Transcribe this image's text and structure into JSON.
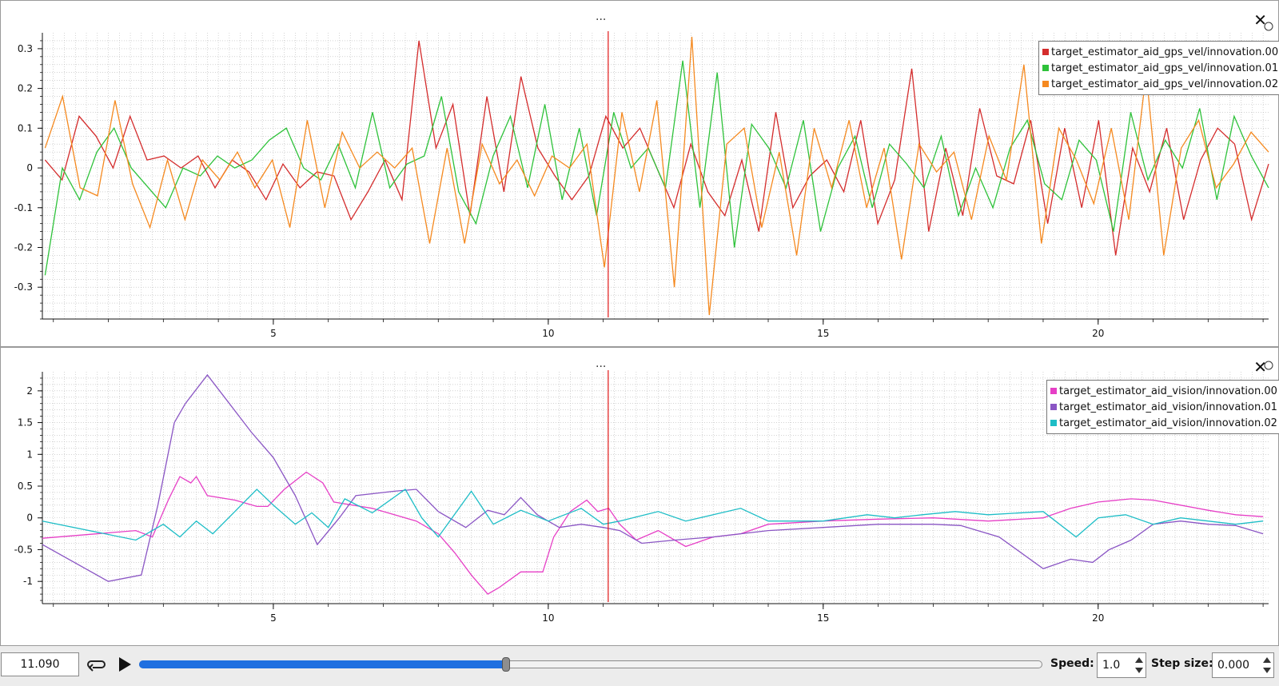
{
  "top_plot": {
    "menu": "...",
    "close": "✕",
    "icon": "close-icon",
    "legend": [
      {
        "label": "target_estimator_aid_gps_vel/innovation.00",
        "color": "#d42c2c"
      },
      {
        "label": "target_estimator_aid_gps_vel/innovation.01",
        "color": "#2ec23a"
      },
      {
        "label": "target_estimator_aid_gps_vel/innovation.02",
        "color": "#f5891f"
      }
    ],
    "y_ticks": [
      "0.3",
      "0.2",
      "0.1",
      "0",
      "-0.1",
      "-0.2",
      "-0.3"
    ],
    "x_ticks": [
      "5",
      "10",
      "15",
      "20"
    ]
  },
  "bottom_plot": {
    "menu": "...",
    "close": "✕",
    "icon": "close-icon",
    "legend": [
      {
        "label": "target_estimator_aid_vision/innovation.00",
        "color": "#e63fc6"
      },
      {
        "label": "target_estimator_aid_vision/innovation.01",
        "color": "#8a55c4"
      },
      {
        "label": "target_estimator_aid_vision/innovation.02",
        "color": "#1dbdc6"
      }
    ],
    "y_ticks": [
      "2",
      "1.5",
      "1",
      "0.5",
      "0",
      "-0.5",
      "-1"
    ],
    "x_ticks": [
      "5",
      "10",
      "15",
      "20"
    ]
  },
  "controls": {
    "time_value": "11.090",
    "loop_icon": "loop-icon",
    "play_icon": "play-icon",
    "slider_progress": 0.406,
    "speed_label": "Speed:",
    "speed_value": "1.0",
    "step_label": "Step size:",
    "step_value": "0.000"
  },
  "chart_data": [
    {
      "type": "line",
      "x_range": [
        0.8,
        23.1
      ],
      "ylim": [
        -0.38,
        0.34
      ],
      "cursor_x": 11.09,
      "series": [
        {
          "name": "target_estimator_aid_gps_vel/innovation.00",
          "color": "#d42c2c",
          "values": [
            0.02,
            -0.03,
            0.13,
            0.08,
            0.0,
            0.13,
            0.02,
            0.03,
            0.0,
            0.03,
            -0.05,
            0.02,
            -0.01,
            -0.08,
            0.01,
            -0.05,
            -0.01,
            -0.02,
            -0.13,
            -0.06,
            0.02,
            -0.08,
            0.32,
            0.05,
            0.16,
            -0.12,
            0.18,
            -0.06,
            0.23,
            0.05,
            -0.02,
            -0.08,
            -0.02,
            0.13,
            0.05,
            0.1,
            0.0,
            -0.1,
            0.06,
            -0.06,
            -0.12,
            0.02,
            -0.16,
            0.14,
            -0.1,
            -0.02,
            0.02,
            -0.06,
            0.12,
            -0.14,
            -0.03,
            0.25,
            -0.16,
            0.05,
            -0.12,
            0.15,
            -0.02,
            -0.04,
            0.12,
            -0.14,
            0.1,
            -0.1,
            0.12,
            -0.22,
            0.05,
            -0.06,
            0.1,
            -0.13,
            0.02,
            0.1,
            0.06,
            -0.13,
            0.01
          ]
        },
        {
          "name": "target_estimator_aid_gps_vel/innovation.01",
          "color": "#2ec23a",
          "values": [
            -0.27,
            0.0,
            -0.08,
            0.04,
            0.1,
            0.0,
            -0.05,
            -0.1,
            0.0,
            -0.02,
            0.03,
            0.0,
            0.02,
            0.07,
            0.1,
            0.0,
            -0.03,
            0.06,
            -0.05,
            0.14,
            -0.05,
            0.01,
            0.03,
            0.18,
            -0.06,
            -0.14,
            0.03,
            0.13,
            -0.05,
            0.16,
            -0.08,
            0.1,
            -0.12,
            0.14,
            0.0,
            0.05,
            -0.05,
            0.27,
            -0.1,
            0.24,
            -0.2,
            0.11,
            0.05,
            -0.05,
            0.12,
            -0.16,
            0.0,
            0.08,
            -0.1,
            0.06,
            0.01,
            -0.05,
            0.08,
            -0.12,
            0.0,
            -0.1,
            0.05,
            0.12,
            -0.04,
            -0.08,
            0.07,
            0.02,
            -0.16,
            0.14,
            -0.03,
            0.07,
            0.0,
            0.15,
            -0.08,
            0.13,
            0.03,
            -0.05
          ]
        },
        {
          "name": "target_estimator_aid_gps_vel/innovation.02",
          "color": "#f5891f",
          "values": [
            0.05,
            0.18,
            -0.05,
            -0.07,
            0.17,
            -0.04,
            -0.15,
            0.02,
            -0.13,
            0.02,
            -0.03,
            0.04,
            -0.05,
            0.02,
            -0.15,
            0.12,
            -0.1,
            0.09,
            0.0,
            0.04,
            0.0,
            0.05,
            -0.19,
            0.05,
            -0.19,
            0.06,
            -0.04,
            0.02,
            -0.07,
            0.03,
            0.0,
            0.06,
            -0.25,
            0.14,
            -0.06,
            0.17,
            -0.3,
            0.33,
            -0.37,
            0.06,
            0.1,
            -0.15,
            0.04,
            -0.22,
            0.1,
            -0.05,
            0.12,
            -0.1,
            0.05,
            -0.23,
            0.06,
            -0.01,
            0.04,
            -0.13,
            0.08,
            -0.03,
            0.26,
            -0.19,
            0.1,
            0.02,
            -0.09,
            0.1,
            -0.13,
            0.24,
            -0.22,
            0.05,
            0.12,
            -0.05,
            0.01,
            0.09,
            0.04
          ]
        }
      ]
    },
    {
      "type": "line",
      "x_range": [
        0.8,
        23.1
      ],
      "ylim": [
        -1.35,
        2.3
      ],
      "cursor_x": 11.09,
      "series": [
        {
          "name": "target_estimator_aid_vision/innovation.00",
          "color": "#e63fc6",
          "points": [
            [
              0.8,
              -0.32
            ],
            [
              2.5,
              -0.2
            ],
            [
              2.8,
              -0.3
            ],
            [
              3.1,
              0.3
            ],
            [
              3.3,
              0.65
            ],
            [
              3.5,
              0.55
            ],
            [
              3.6,
              0.65
            ],
            [
              3.8,
              0.35
            ],
            [
              4.3,
              0.28
            ],
            [
              4.7,
              0.18
            ],
            [
              4.9,
              0.18
            ],
            [
              5.2,
              0.45
            ],
            [
              5.6,
              0.72
            ],
            [
              5.9,
              0.55
            ],
            [
              6.1,
              0.25
            ],
            [
              6.8,
              0.15
            ],
            [
              7.2,
              0.05
            ],
            [
              7.6,
              -0.05
            ],
            [
              8.0,
              -0.25
            ],
            [
              8.3,
              -0.55
            ],
            [
              8.6,
              -0.9
            ],
            [
              8.9,
              -1.2
            ],
            [
              9.1,
              -1.1
            ],
            [
              9.5,
              -0.85
            ],
            [
              9.9,
              -0.85
            ],
            [
              10.1,
              -0.3
            ],
            [
              10.4,
              0.1
            ],
            [
              10.7,
              0.28
            ],
            [
              10.9,
              0.1
            ],
            [
              11.1,
              0.15
            ],
            [
              11.3,
              -0.1
            ],
            [
              11.6,
              -0.35
            ],
            [
              12.0,
              -0.2
            ],
            [
              12.5,
              -0.45
            ],
            [
              13.0,
              -0.3
            ],
            [
              13.5,
              -0.25
            ],
            [
              14.0,
              -0.1
            ],
            [
              15.0,
              -0.05
            ],
            [
              16.0,
              -0.02
            ],
            [
              17.0,
              0.0
            ],
            [
              18.0,
              -0.05
            ],
            [
              19.0,
              0.0
            ],
            [
              19.5,
              0.15
            ],
            [
              20.0,
              0.25
            ],
            [
              20.6,
              0.3
            ],
            [
              21.0,
              0.28
            ],
            [
              21.5,
              0.2
            ],
            [
              22.0,
              0.12
            ],
            [
              22.5,
              0.05
            ],
            [
              23.0,
              0.02
            ]
          ]
        },
        {
          "name": "target_estimator_aid_vision/innovation.01",
          "color": "#8a55c4",
          "points": [
            [
              0.8,
              -0.42
            ],
            [
              2.0,
              -1.0
            ],
            [
              2.6,
              -0.9
            ],
            [
              2.9,
              0.2
            ],
            [
              3.2,
              1.5
            ],
            [
              3.4,
              1.8
            ],
            [
              3.8,
              2.25
            ],
            [
              4.2,
              1.8
            ],
            [
              4.6,
              1.35
            ],
            [
              5.0,
              0.95
            ],
            [
              5.4,
              0.35
            ],
            [
              5.8,
              -0.42
            ],
            [
              6.2,
              0.0
            ],
            [
              6.5,
              0.35
            ],
            [
              7.2,
              0.42
            ],
            [
              7.6,
              0.45
            ],
            [
              8.0,
              0.1
            ],
            [
              8.5,
              -0.15
            ],
            [
              8.9,
              0.12
            ],
            [
              9.2,
              0.05
            ],
            [
              9.5,
              0.32
            ],
            [
              9.8,
              0.05
            ],
            [
              10.2,
              -0.15
            ],
            [
              10.6,
              -0.1
            ],
            [
              11.0,
              -0.15
            ],
            [
              11.3,
              -0.2
            ],
            [
              11.7,
              -0.4
            ],
            [
              12.3,
              -0.35
            ],
            [
              13.0,
              -0.3
            ],
            [
              14.0,
              -0.2
            ],
            [
              15.0,
              -0.15
            ],
            [
              16.0,
              -0.1
            ],
            [
              17.0,
              -0.1
            ],
            [
              17.5,
              -0.12
            ],
            [
              18.2,
              -0.3
            ],
            [
              19.0,
              -0.8
            ],
            [
              19.5,
              -0.65
            ],
            [
              19.9,
              -0.7
            ],
            [
              20.2,
              -0.5
            ],
            [
              20.6,
              -0.35
            ],
            [
              21.0,
              -0.1
            ],
            [
              21.5,
              -0.05
            ],
            [
              22.0,
              -0.1
            ],
            [
              22.5,
              -0.12
            ],
            [
              23.0,
              -0.25
            ]
          ]
        },
        {
          "name": "target_estimator_aid_vision/innovation.02",
          "color": "#1dbdc6",
          "points": [
            [
              0.8,
              -0.05
            ],
            [
              2.5,
              -0.35
            ],
            [
              2.8,
              -0.2
            ],
            [
              3.0,
              -0.1
            ],
            [
              3.3,
              -0.3
            ],
            [
              3.6,
              -0.05
            ],
            [
              3.9,
              -0.25
            ],
            [
              4.3,
              0.1
            ],
            [
              4.7,
              0.45
            ],
            [
              5.0,
              0.2
            ],
            [
              5.4,
              -0.1
            ],
            [
              5.7,
              0.08
            ],
            [
              6.0,
              -0.15
            ],
            [
              6.3,
              0.3
            ],
            [
              6.8,
              0.08
            ],
            [
              7.4,
              0.45
            ],
            [
              7.7,
              0.0
            ],
            [
              8.0,
              -0.3
            ],
            [
              8.6,
              0.42
            ],
            [
              9.0,
              -0.1
            ],
            [
              9.5,
              0.12
            ],
            [
              10.0,
              -0.05
            ],
            [
              10.6,
              0.15
            ],
            [
              11.0,
              -0.1
            ],
            [
              11.3,
              -0.05
            ],
            [
              12.0,
              0.1
            ],
            [
              12.5,
              -0.05
            ],
            [
              13.0,
              0.05
            ],
            [
              13.5,
              0.15
            ],
            [
              14.0,
              -0.05
            ],
            [
              15.0,
              -0.05
            ],
            [
              15.8,
              0.05
            ],
            [
              16.3,
              0.0
            ],
            [
              16.8,
              0.05
            ],
            [
              17.4,
              0.1
            ],
            [
              18.0,
              0.05
            ],
            [
              19.0,
              0.1
            ],
            [
              19.6,
              -0.3
            ],
            [
              20.0,
              0.0
            ],
            [
              20.5,
              0.05
            ],
            [
              21.0,
              -0.1
            ],
            [
              21.5,
              0.0
            ],
            [
              22.0,
              -0.05
            ],
            [
              22.5,
              -0.1
            ],
            [
              23.0,
              -0.05
            ]
          ]
        }
      ]
    }
  ]
}
